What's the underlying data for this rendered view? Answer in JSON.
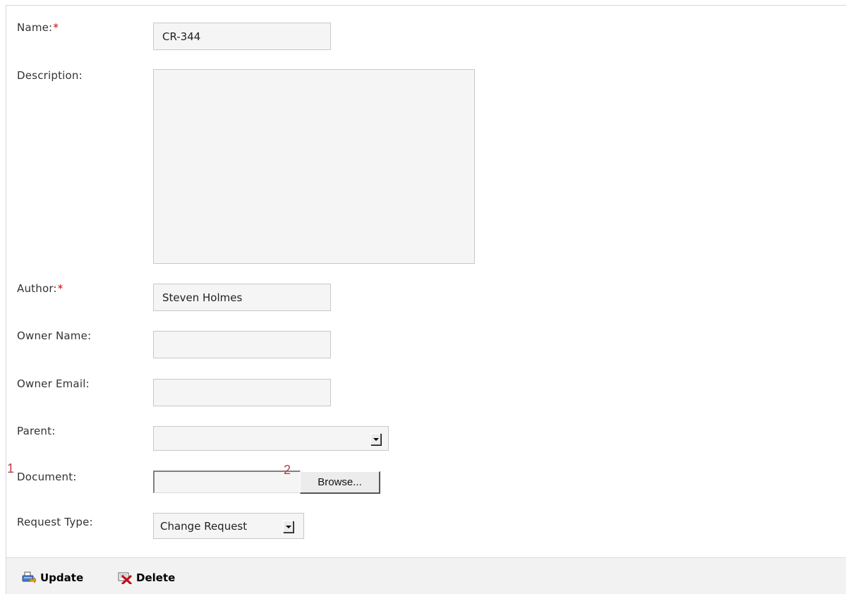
{
  "form": {
    "name": {
      "label": "Name:",
      "required_mark": "*",
      "value": "CR-344"
    },
    "description": {
      "label": "Description:",
      "value": ""
    },
    "author": {
      "label": "Author:",
      "required_mark": "*",
      "value": "Steven Holmes"
    },
    "owner_name": {
      "label": "Owner Name:",
      "value": ""
    },
    "owner_email": {
      "label": "Owner Email:",
      "value": ""
    },
    "parent": {
      "label": "Parent:",
      "value": ""
    },
    "document": {
      "label": "Document:",
      "value": "",
      "browse_label": "Browse..."
    },
    "request_type": {
      "label": "Request Type:",
      "value": "Change Request"
    }
  },
  "annotations": {
    "marker_1": "1",
    "marker_2": "2"
  },
  "toolbar": {
    "update_label": "Update",
    "delete_label": "Delete",
    "update_icon": "update-icon",
    "delete_icon": "delete-icon"
  },
  "colors": {
    "required": "#cc0000",
    "annotation": "#c0394b",
    "field_background": "#f5f5f5",
    "toolbar_background": "#f2f2f2"
  }
}
